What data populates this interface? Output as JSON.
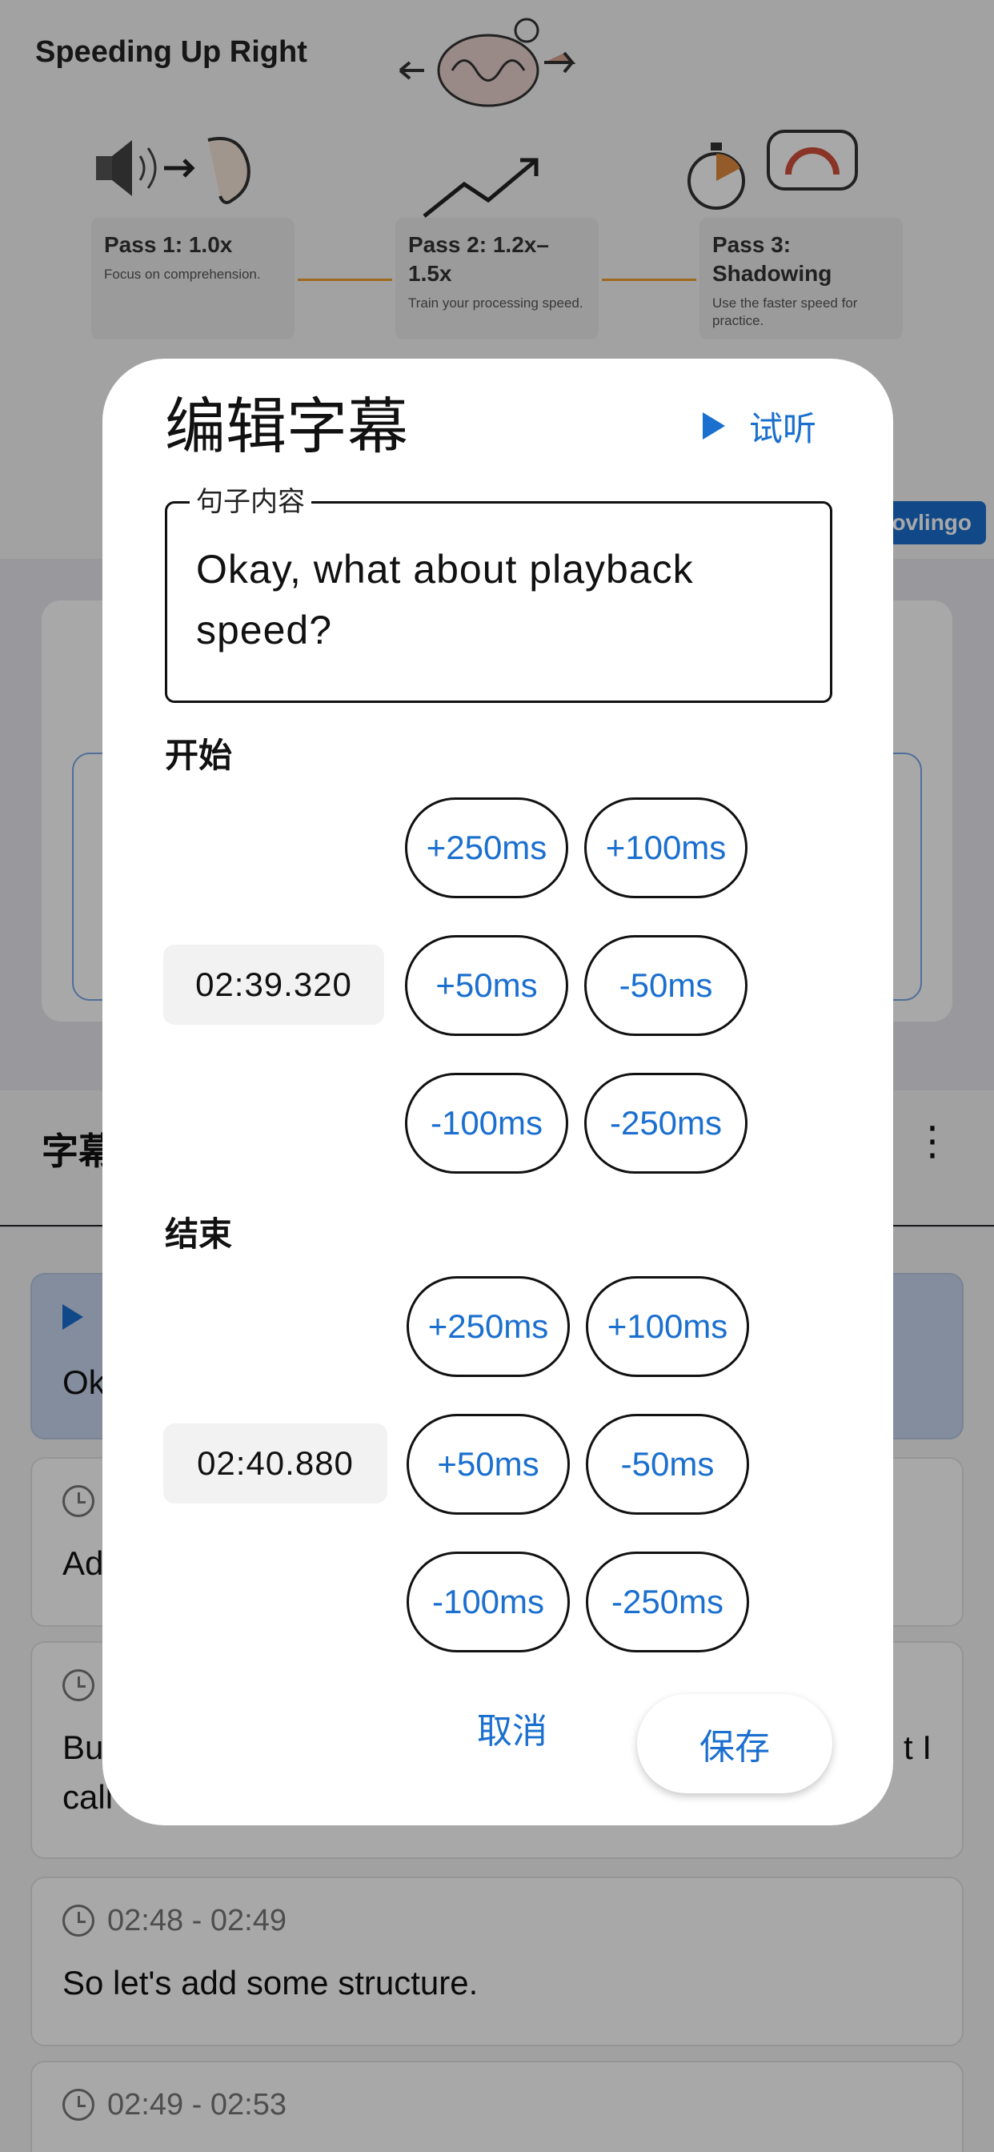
{
  "video": {
    "slide_title": "Speeding Up Right",
    "passes": [
      {
        "title": "Pass 1: 1.0x",
        "desc": "Focus on comprehension."
      },
      {
        "title": "Pass 2: 1.2x–1.5x",
        "desc": "Train your processing speed."
      },
      {
        "title": "Pass 3: Shadowing",
        "desc": "Use the faster speed for practice."
      }
    ],
    "brand": "ovlingo"
  },
  "subtitles_panel": {
    "header_label": "字幕",
    "more_icon": "more-vertical-icon",
    "items": [
      {
        "time": "",
        "text": "Ok",
        "active": true
      },
      {
        "time": "",
        "text": "Ad",
        "active": false
      },
      {
        "time": "",
        "text": "Bu",
        "text2": "t I",
        "line2": "call",
        "active": false
      },
      {
        "time": "02:48 - 02:49",
        "text": "So let's add some structure.",
        "active": false
      },
      {
        "time": "02:49 - 02:53",
        "text": "",
        "active": false
      }
    ]
  },
  "dialog": {
    "title": "编辑字幕",
    "preview_label": "试听",
    "sentence_label": "句子内容",
    "sentence_value": "Okay, what about playback speed?",
    "start": {
      "label": "开始",
      "time": "02:39.320",
      "adjust": [
        "+250ms",
        "+100ms",
        "+50ms",
        "-50ms",
        "-100ms",
        "-250ms"
      ]
    },
    "end": {
      "label": "结束",
      "time": "02:40.880",
      "adjust": [
        "+250ms",
        "+100ms",
        "+50ms",
        "-50ms",
        "-100ms",
        "-250ms"
      ]
    },
    "cancel_label": "取消",
    "save_label": "保存"
  },
  "colors": {
    "accent": "#1a6fcf",
    "active_row": "#c9d6ef"
  }
}
